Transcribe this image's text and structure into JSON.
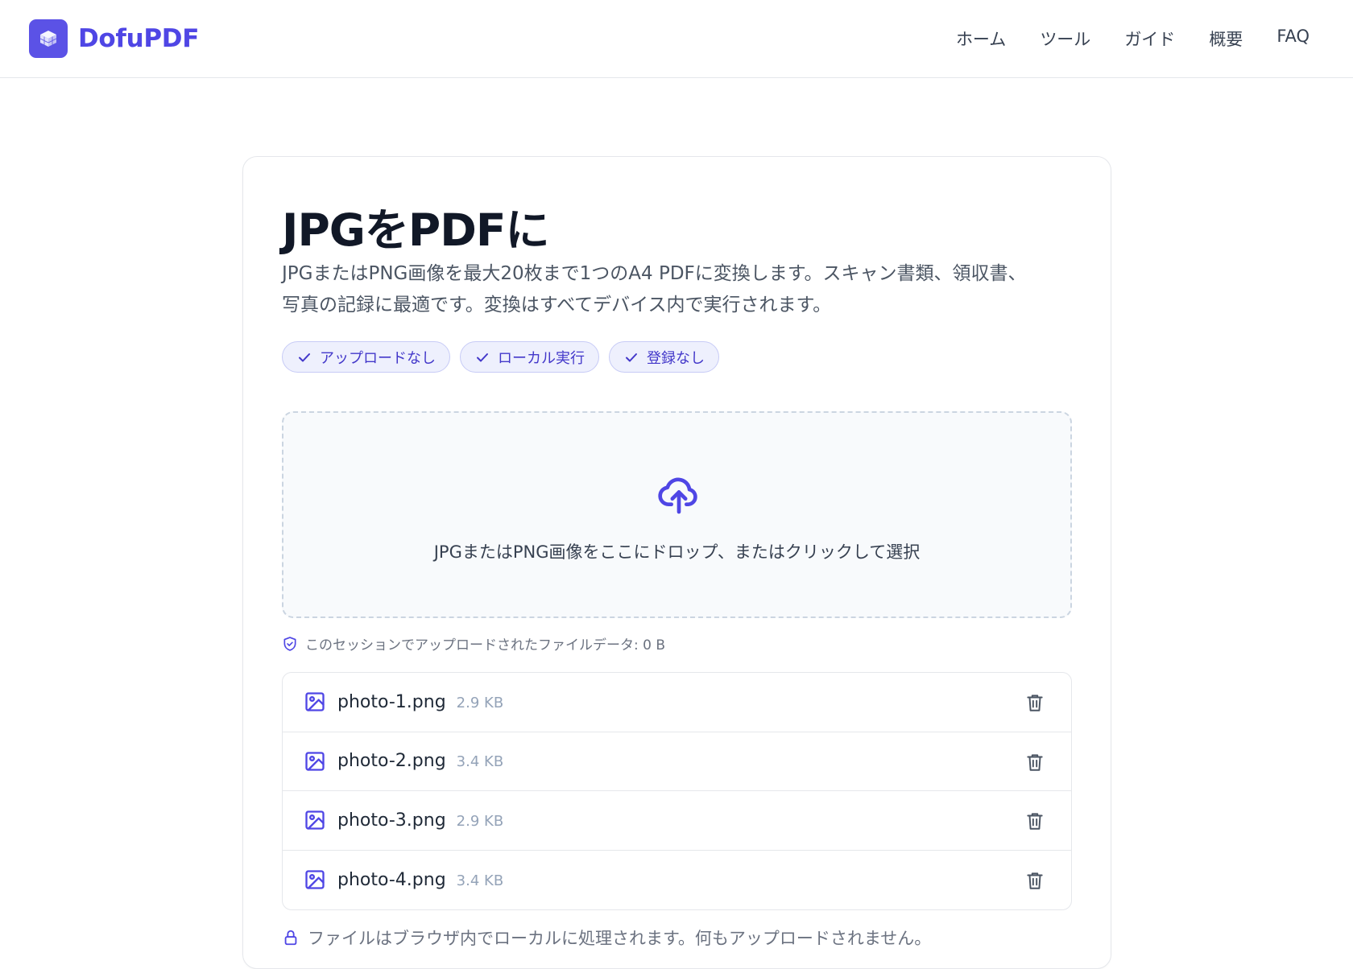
{
  "header": {
    "brand": "DofuPDF",
    "nav": [
      "ホーム",
      "ツール",
      "ガイド",
      "概要",
      "FAQ"
    ]
  },
  "main": {
    "title": "JPGをPDFに",
    "description_line1": "JPGまたはPNG画像を最大20枚まで1つのA4 PDFに変換します。スキャン書類、領収書、",
    "description_line2": "写真の記録に最適です。変換はすべてデバイス内で実行されます。",
    "badges": [
      "アップロードなし",
      "ローカル実行",
      "登録なし"
    ],
    "dropzone_text": "JPGまたはPNG画像をここにドロップ、またはクリックして選択",
    "session_text": "このセッションでアップロードされたファイルデータ: 0 B",
    "files": [
      {
        "name": "photo-1.png",
        "size": "2.9 KB"
      },
      {
        "name": "photo-2.png",
        "size": "3.4 KB"
      },
      {
        "name": "photo-3.png",
        "size": "2.9 KB"
      },
      {
        "name": "photo-4.png",
        "size": "3.4 KB"
      }
    ],
    "local_note": "ファイルはブラウザ内でローカルに処理されます。何もアップロードされません。"
  },
  "colors": {
    "accent": "#4f46e5",
    "badge_bg": "#eef0fd",
    "title": "#111827",
    "muted": "#6b7280"
  }
}
